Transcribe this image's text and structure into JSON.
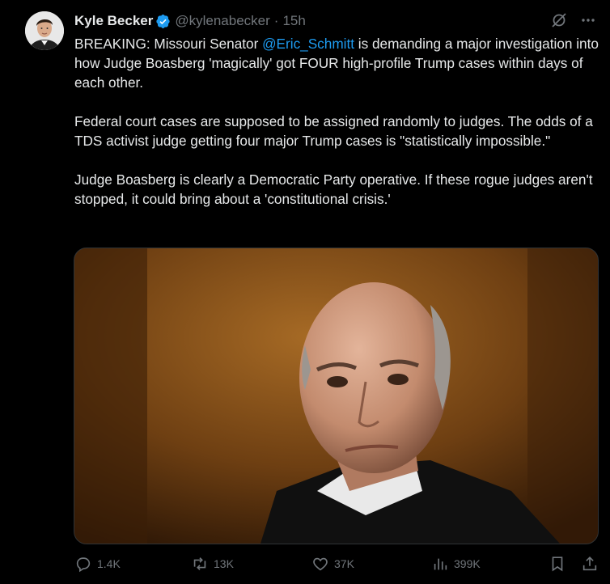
{
  "author": {
    "display_name": "Kyle Becker",
    "handle": "@kylenabecker",
    "separator": "·",
    "time": "15h",
    "verified": true
  },
  "icons": {
    "avatar": "avatar",
    "verified": "verified-badge-icon",
    "grok": "grok-icon",
    "more": "more-icon",
    "reply": "reply-icon",
    "retweet": "retweet-icon",
    "like": "like-icon",
    "views": "views-icon",
    "bookmark": "bookmark-icon",
    "share": "share-icon"
  },
  "tweet": {
    "p1_before": "BREAKING: Missouri Senator ",
    "p1_mention": "@Eric_Schmitt",
    "p1_after": " is demanding a major investigation into how Judge Boasberg 'magically' got FOUR high-profile Trump cases within days of each other.",
    "p2": "Federal court cases are supposed to be assigned randomly to judges. The odds of a TDS activist judge getting four major Trump cases is \"statistically impossible.\"",
    "p3": "Judge Boasberg is clearly a Democratic Party operative. If these rogue judges aren't stopped, it could bring about a 'constitutional crisis.'"
  },
  "stats": {
    "replies": "1.4K",
    "retweets": "13K",
    "likes": "37K",
    "views": "399K"
  },
  "colors": {
    "background": "#000000",
    "text": "#e7e9ea",
    "muted": "#71767b",
    "accent": "#1d9bf0"
  }
}
